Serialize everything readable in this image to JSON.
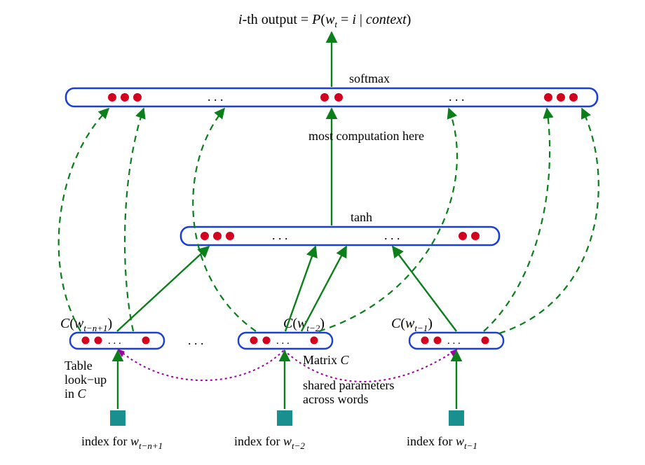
{
  "diagram": {
    "title_prefix": "i",
    "title_suffix": "-th output = ",
    "prob_P": "P",
    "prob_open": "(",
    "prob_w": "w",
    "prob_wsub": "t",
    "prob_eq": " = ",
    "prob_i": "i",
    "prob_bar": " | ",
    "prob_ctx": "context",
    "prob_close": ")",
    "softmax": "softmax",
    "most_comp": "most  computation here",
    "tanh": "tanh",
    "C_label_main": "C",
    "C_label_open": "(",
    "C_label_w": "w",
    "embed1_sub": "t−n+1",
    "embed2_sub": "t−2",
    "embed3_sub": "t−1",
    "C_label_close": ")",
    "table_lookup_l1": "Table",
    "table_lookup_l2": "look−up",
    "table_lookup_l3_prefix": "in ",
    "table_lookup_l3_C": "C",
    "matrix_label_prefix": "Matrix ",
    "matrix_label_C": "C",
    "shared_l1": "shared parameters",
    "shared_l2": "across words",
    "index_for": "index for ",
    "index_w": "w",
    "ellipsis": ". . .",
    "colors": {
      "blue": "#1a3fd6",
      "green": "#0a7f1a",
      "red": "#d4001f",
      "magenta": "#a000a0",
      "teal": "#1a8f8f"
    }
  }
}
